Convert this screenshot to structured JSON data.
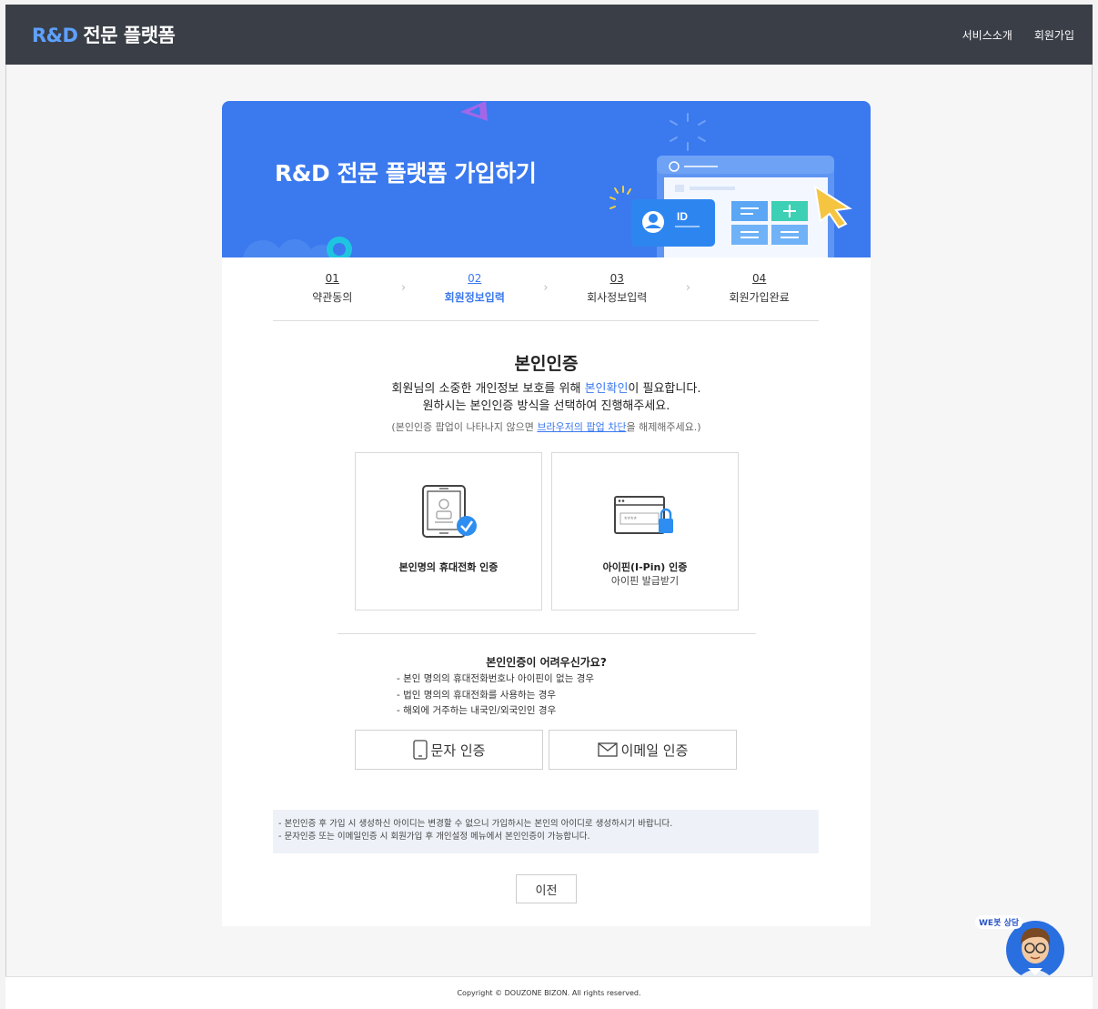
{
  "header": {
    "logo_rd": "R&D",
    "logo_text": "전문 플랫폼",
    "nav": [
      "서비스소개",
      "회원가입"
    ]
  },
  "banner": {
    "title": "R&D 전문 플랫폼 가입하기",
    "id_badge": "ID"
  },
  "steps": [
    {
      "num": "01",
      "label": "약관동의",
      "active": false
    },
    {
      "num": "02",
      "label": "회원정보입력",
      "active": true
    },
    {
      "num": "03",
      "label": "회사정보입력",
      "active": false
    },
    {
      "num": "04",
      "label": "회원가입완료",
      "active": false
    }
  ],
  "auth": {
    "title": "본인인증",
    "desc_line1_pre": "회원님의 소중한 개인정보 보호를 위해 ",
    "desc_line1_link": "본인확인",
    "desc_line1_post": "이 필요합니다.",
    "desc_line2": "원하시는 본인인증 방식을 선택하여 진행해주세요.",
    "note_pre": "(본인인증 팝업이 나타나지 않으면 ",
    "note_link": "브라우저의 팝업 차단",
    "note_post": "을 해제해주세요.)"
  },
  "methods": {
    "phone": {
      "label": "본인명의 휴대전화 인증"
    },
    "ipin": {
      "label": "아이핀(I-Pin) 인증",
      "sub": "아이핀 발급받기",
      "mask": "****"
    }
  },
  "help": {
    "title": "본인인증이 어려우신가요?",
    "items": [
      "- 본인 명의의 휴대전화번호나 아이핀이 없는 경우",
      "- 법인 명의의 휴대전화를 사용하는 경우",
      "- 해외에 거주하는 내국인/외국인인 경우"
    ]
  },
  "alt_buttons": {
    "sms": "문자 인증",
    "email": "이메일 인증"
  },
  "notice": [
    "- 본인인증 후 가입 시 생성하신 아이디는 변경할 수 없으니 가입하시는 본인의 아이디로 생성하시기 바랍니다.",
    "- 문자인증 또는 이메일인증 시 회원가입 후 개인설정 메뉴에서 본인인증이 가능합니다."
  ],
  "prev_button": "이전",
  "footer": "Copyright © DOUZONE BIZON. All rights reserved.",
  "chatbot": {
    "label": "WE봇 상담"
  },
  "colors": {
    "primary": "#3b79ee",
    "topbar": "#3a3e47",
    "logo_accent": "#5da1ff"
  }
}
